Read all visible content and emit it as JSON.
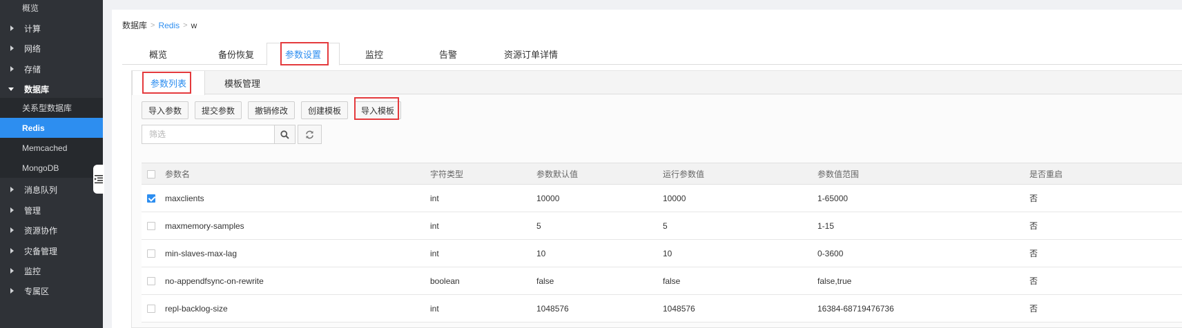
{
  "sidebar": {
    "items": [
      {
        "label": "概览",
        "type": "sub"
      },
      {
        "label": "计算",
        "type": "group"
      },
      {
        "label": "网络",
        "type": "group"
      },
      {
        "label": "存储",
        "type": "group"
      },
      {
        "label": "数据库",
        "type": "group-open"
      },
      {
        "label": "关系型数据库",
        "type": "sub"
      },
      {
        "label": "Redis",
        "type": "sub-active"
      },
      {
        "label": "Memcached",
        "type": "sub"
      },
      {
        "label": "MongoDB",
        "type": "sub"
      },
      {
        "label": "消息队列",
        "type": "group"
      },
      {
        "label": "管理",
        "type": "group"
      },
      {
        "label": "资源协作",
        "type": "group"
      },
      {
        "label": "灾备管理",
        "type": "group"
      },
      {
        "label": "监控",
        "type": "group"
      },
      {
        "label": "专属区",
        "type": "group"
      }
    ]
  },
  "breadcrumb": {
    "root": "数据库",
    "sep": ">",
    "middle": "Redis",
    "current": "w"
  },
  "tabs": [
    {
      "label": "概览"
    },
    {
      "label": "备份恢复"
    },
    {
      "label": "参数设置"
    },
    {
      "label": "监控"
    },
    {
      "label": "告警"
    },
    {
      "label": "资源订单详情"
    }
  ],
  "subtabs": [
    {
      "label": "参数列表"
    },
    {
      "label": "模板管理"
    }
  ],
  "toolbar": {
    "import_params": "导入参数",
    "submit_params": "提交参数",
    "undo_changes": "撤销修改",
    "create_template": "创建模板",
    "import_template": "导入模板"
  },
  "filter": {
    "placeholder": "筛选",
    "value": ""
  },
  "table": {
    "headers": [
      "参数名",
      "字符类型",
      "参数默认值",
      "运行参数值",
      "参数值范围",
      "是否重启"
    ],
    "rows": [
      {
        "checked": true,
        "cells": [
          "maxclients",
          "int",
          "10000",
          "10000",
          "1-65000",
          "否"
        ]
      },
      {
        "checked": false,
        "cells": [
          "maxmemory-samples",
          "int",
          "5",
          "5",
          "1-15",
          "否"
        ]
      },
      {
        "checked": false,
        "cells": [
          "min-slaves-max-lag",
          "int",
          "10",
          "10",
          "0-3600",
          "否"
        ]
      },
      {
        "checked": false,
        "cells": [
          "no-appendfsync-on-rewrite",
          "boolean",
          "false",
          "false",
          "false,true",
          "否"
        ]
      },
      {
        "checked": false,
        "cells": [
          "repl-backlog-size",
          "int",
          "1048576",
          "1048576",
          "16384-68719476736",
          "否"
        ]
      }
    ]
  },
  "colors": {
    "accent": "#2d8ef0",
    "sidebar_bg": "#2f3237",
    "highlight_box": "#e4393c"
  }
}
